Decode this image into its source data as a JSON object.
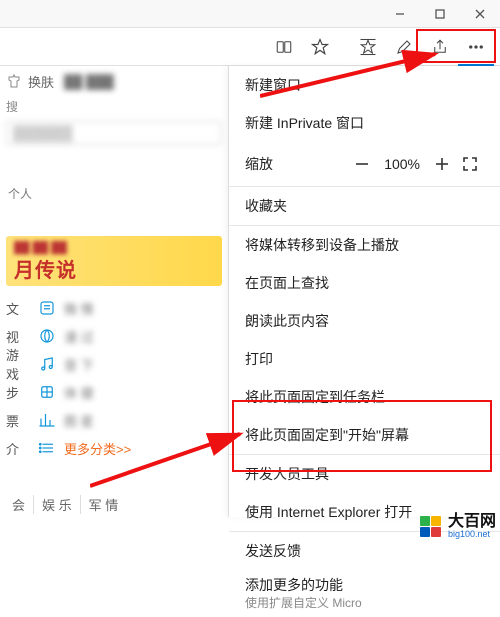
{
  "window_controls": {
    "min": "minimize-icon",
    "max": "maximize-icon",
    "close": "close-icon"
  },
  "toolbar": {
    "reading": "reading-list-icon",
    "star": "favorite-star-icon",
    "favlist": "favorites-pane-icon",
    "pen": "web-note-icon",
    "share": "share-icon",
    "more": "more-icon"
  },
  "left": {
    "tab_label": "换肤",
    "profile_text": "个人",
    "more_cat": "更多分类>>",
    "banner_line2": "月传说",
    "rows": [
      {
        "lbl": "文",
        "txt": "微   情"
      },
      {
        "lbl": "视",
        "txt": "漫   过"
      },
      {
        "lbl": "游戏",
        "txt": "音   下"
      },
      {
        "lbl": "步",
        "txt": "体   健"
      },
      {
        "lbl": "票",
        "txt": "图   星"
      },
      {
        "lbl": "介",
        "txt": ""
      }
    ],
    "bottom_tabs": [
      "会",
      "娱 乐",
      "军 情"
    ]
  },
  "menu": {
    "new_window": "新建窗口",
    "new_inprivate": "新建 InPrivate 窗口",
    "zoom_label": "缩放",
    "zoom_pct": "100%",
    "favorites": "收藏夹",
    "cast": "将媒体转移到设备上播放",
    "find": "在页面上查找",
    "read_aloud": "朗读此页内容",
    "print": "打印",
    "pin_taskbar": "将此页面固定到任务栏",
    "pin_start": "将此页面固定到\"开始\"屏幕",
    "dev_tools": "开发人员工具",
    "open_ie": "使用 Internet Explorer 打开",
    "feedback": "发送反馈",
    "more_features": "添加更多的功能",
    "more_features_sub": "使用扩展自定义 Micro"
  },
  "watermark": {
    "cn": "大百网",
    "en": "big100.net"
  }
}
